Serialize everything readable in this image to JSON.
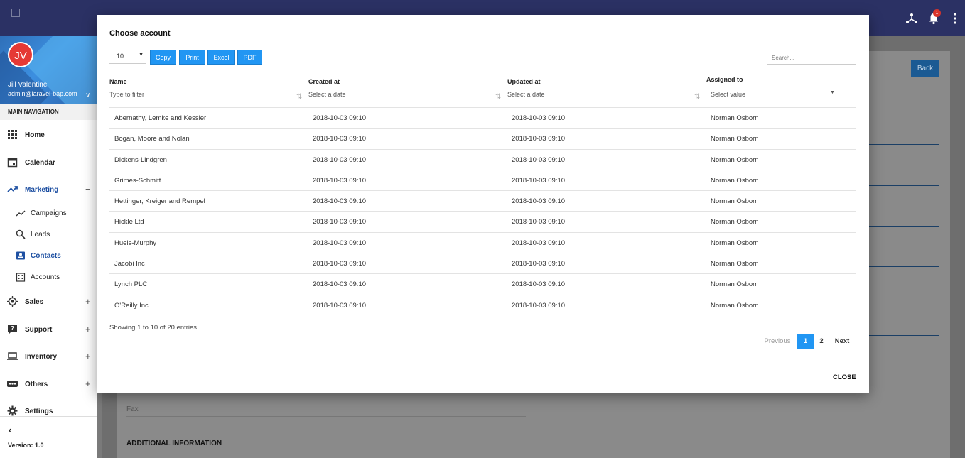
{
  "topbar": {
    "notification_count": "1"
  },
  "sidebar": {
    "user": {
      "initials": "JV",
      "name": "Jill Valentine",
      "email": "admin@laravel-bap.com"
    },
    "nav_header": "MAIN NAVIGATION",
    "items": {
      "home": "Home",
      "calendar": "Calendar",
      "marketing": "Marketing",
      "campaigns": "Campaigns",
      "leads": "Leads",
      "contacts": "Contacts",
      "accounts": "Accounts",
      "sales": "Sales",
      "support": "Support",
      "inventory": "Inventory",
      "others": "Others",
      "settings": "Settings"
    },
    "collapse": "‹",
    "version": "Version: 1.0"
  },
  "background": {
    "back_label": "Back",
    "fax_label": "Fax",
    "section_title": "ADDITIONAL INFORMATION"
  },
  "modal": {
    "title": "Choose account",
    "page_length": "10",
    "buttons": {
      "copy": "Copy",
      "print": "Print",
      "excel": "Excel",
      "pdf": "PDF"
    },
    "search_placeholder": "Search...",
    "columns": {
      "name": "Name",
      "created": "Created at",
      "updated": "Updated at",
      "assigned": "Assigned to"
    },
    "filters": {
      "name": "Type to filter",
      "created": "Select a date",
      "updated": "Select a date",
      "assigned": "Select value"
    },
    "rows": [
      {
        "name": "Abernathy, Lemke and Kessler",
        "created": "2018-10-03 09:10",
        "updated": "2018-10-03 09:10",
        "assigned": "Norman Osborn"
      },
      {
        "name": "Bogan, Moore and Nolan",
        "created": "2018-10-03 09:10",
        "updated": "2018-10-03 09:10",
        "assigned": "Norman Osborn"
      },
      {
        "name": "Dickens-Lindgren",
        "created": "2018-10-03 09:10",
        "updated": "2018-10-03 09:10",
        "assigned": "Norman Osborn"
      },
      {
        "name": "Grimes-Schmitt",
        "created": "2018-10-03 09:10",
        "updated": "2018-10-03 09:10",
        "assigned": "Norman Osborn"
      },
      {
        "name": "Hettinger, Kreiger and Rempel",
        "created": "2018-10-03 09:10",
        "updated": "2018-10-03 09:10",
        "assigned": "Norman Osborn"
      },
      {
        "name": "Hickle Ltd",
        "created": "2018-10-03 09:10",
        "updated": "2018-10-03 09:10",
        "assigned": "Norman Osborn"
      },
      {
        "name": "Huels-Murphy",
        "created": "2018-10-03 09:10",
        "updated": "2018-10-03 09:10",
        "assigned": "Norman Osborn"
      },
      {
        "name": "Jacobi Inc",
        "created": "2018-10-03 09:10",
        "updated": "2018-10-03 09:10",
        "assigned": "Norman Osborn"
      },
      {
        "name": "Lynch PLC",
        "created": "2018-10-03 09:10",
        "updated": "2018-10-03 09:10",
        "assigned": "Norman Osborn"
      },
      {
        "name": "O'Reilly Inc",
        "created": "2018-10-03 09:10",
        "updated": "2018-10-03 09:10",
        "assigned": "Norman Osborn"
      }
    ],
    "info": "Showing 1 to 10 of 20 entries",
    "pagination": {
      "previous": "Previous",
      "page1": "1",
      "page2": "2",
      "next": "Next"
    },
    "close": "CLOSE"
  }
}
